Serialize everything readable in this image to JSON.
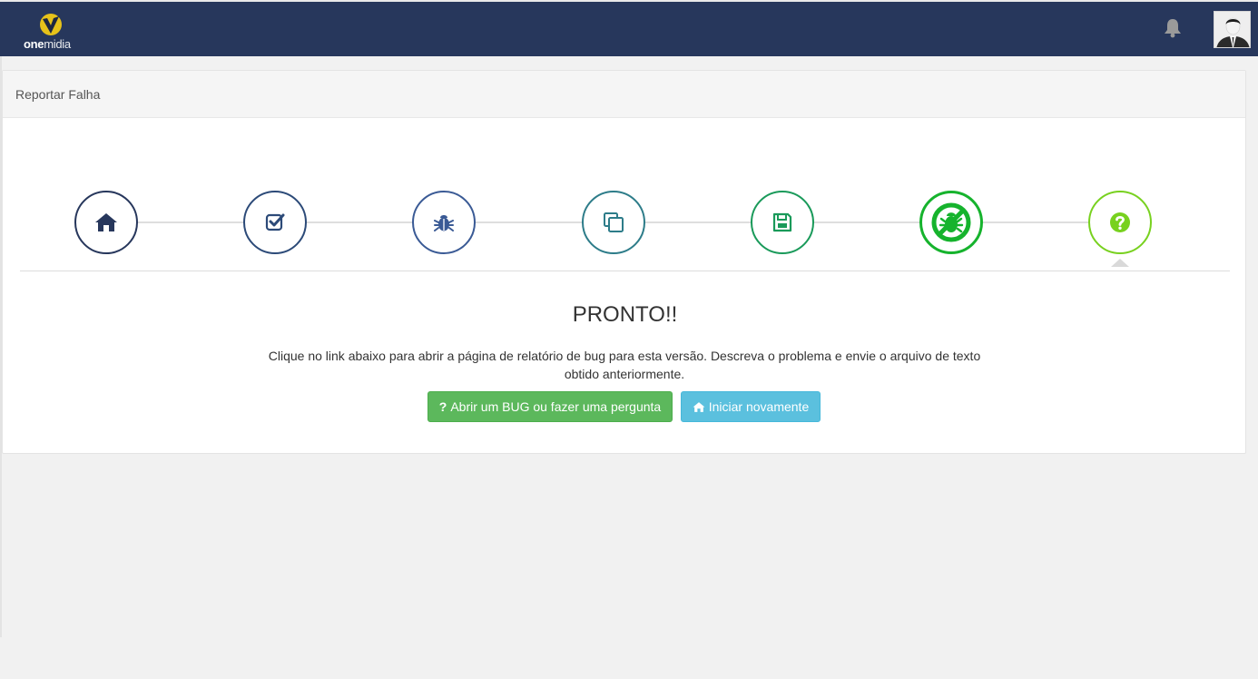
{
  "header": {
    "logo_bold": "one",
    "logo_light": "midia"
  },
  "panel": {
    "title": "Reportar Falha"
  },
  "steps": [
    {
      "icon": "home-icon",
      "color": "#27375c"
    },
    {
      "icon": "checkbox-icon",
      "color": "#2c4a78"
    },
    {
      "icon": "bug-icon",
      "color": "#3a5a95"
    },
    {
      "icon": "copy-icon",
      "color": "#2d7c89"
    },
    {
      "icon": "save-icon",
      "color": "#1a9a5a"
    },
    {
      "icon": "no-bug-icon",
      "color": "#16b32d"
    },
    {
      "icon": "question-icon",
      "color": "#78d11f"
    }
  ],
  "main": {
    "heading": "PRONTO!!",
    "description": "Clique no link abaixo para abrir a página de relatório de bug para esta versão. Descreva o problema e envie o arquivo de texto obtido anteriormente.",
    "open_bug_label": "Abrir um BUG ou fazer uma pergunta",
    "open_bug_prefix": "?",
    "restart_label": "Iniciar novamente"
  }
}
